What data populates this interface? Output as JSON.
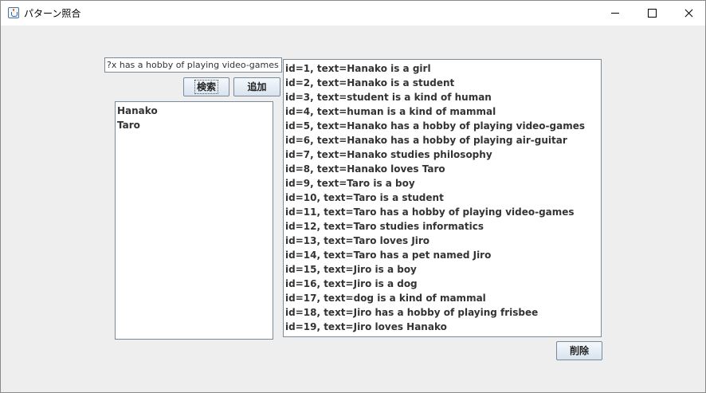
{
  "window": {
    "title": "パターン照合"
  },
  "search": {
    "query": "?x has a hobby of playing video-games"
  },
  "buttons": {
    "search": "検索",
    "add": "追加",
    "delete": "削除"
  },
  "results": [
    "Hanako",
    "Taro"
  ],
  "records": [
    "id=1, text=Hanako is a girl",
    "id=2, text=Hanako is a student",
    "id=3, text=student is a kind of human",
    "id=4, text=human is a kind of mammal",
    "id=5, text=Hanako has a hobby of playing video-games",
    "id=6, text=Hanako has a hobby of playing air-guitar",
    "id=7, text=Hanako studies philosophy",
    "id=8, text=Hanako loves Taro",
    "id=9, text=Taro is a boy",
    "id=10, text=Taro is a student",
    "id=11, text=Taro has a hobby of playing video-games",
    "id=12, text=Taro studies informatics",
    "id=13, text=Taro loves Jiro",
    "id=14, text=Taro has a pet named Jiro",
    "id=15, text=Jiro is a boy",
    "id=16, text=Jiro is a dog",
    "id=17, text=dog is a kind of mammal",
    "id=18, text=Jiro has a hobby of playing frisbee",
    "id=19, text=Jiro loves Hanako"
  ]
}
